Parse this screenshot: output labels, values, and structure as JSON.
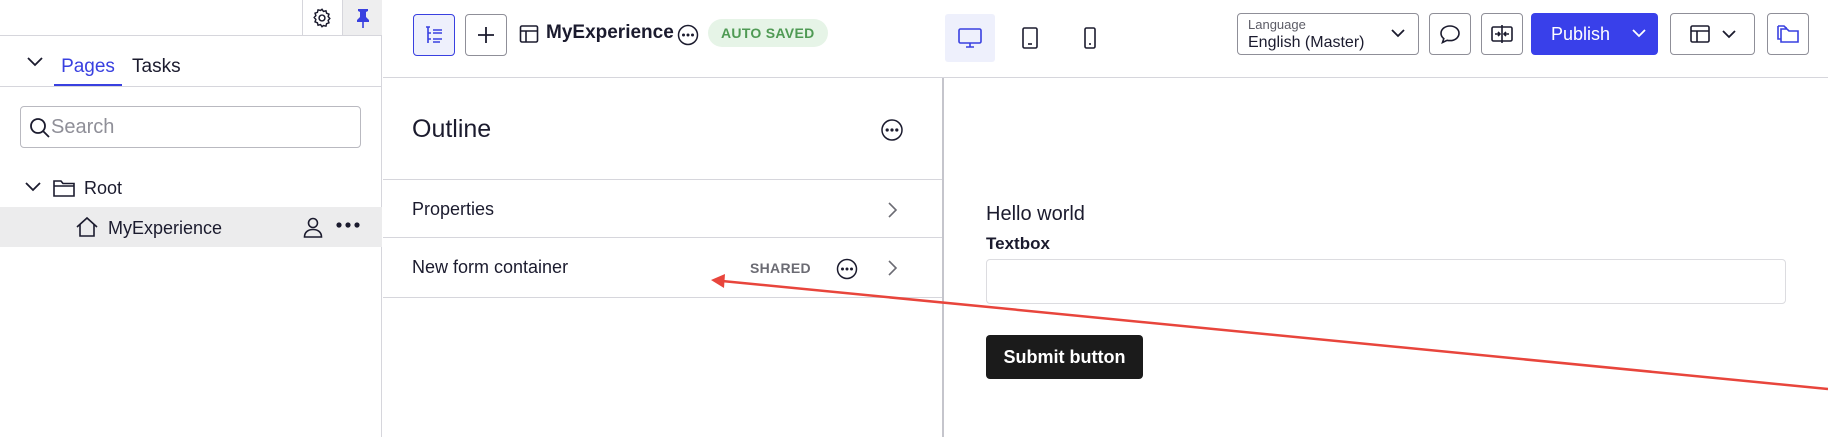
{
  "sidebar": {
    "tabs": [
      {
        "label": "Pages",
        "active": true
      },
      {
        "label": "Tasks",
        "active": false
      }
    ],
    "search": {
      "placeholder": "Search",
      "value": ""
    },
    "tree": {
      "root": {
        "label": "Root",
        "icon": "folder-icon"
      },
      "items": [
        {
          "label": "MyExperience",
          "icon": "home-icon"
        }
      ]
    }
  },
  "toolbar": {
    "page_title": "MyExperience",
    "autosave_status": "AUTO SAVED",
    "language": {
      "caption": "Language",
      "value": "English (Master)"
    },
    "publish_label": "Publish"
  },
  "outline": {
    "title": "Outline",
    "rows": [
      {
        "label": "Properties"
      },
      {
        "label": "New form container",
        "badge": "SHARED"
      }
    ]
  },
  "canvas": {
    "heading": "Hello world",
    "textbox_label": "Textbox",
    "textbox_value": "",
    "submit_label": "Submit button"
  },
  "colors": {
    "accent": "#3940ea",
    "autosave_bg": "#e6f4e7",
    "autosave_text": "#4f9a54",
    "annotation": "#e8453c",
    "submit_bg": "#1b1b1b"
  }
}
